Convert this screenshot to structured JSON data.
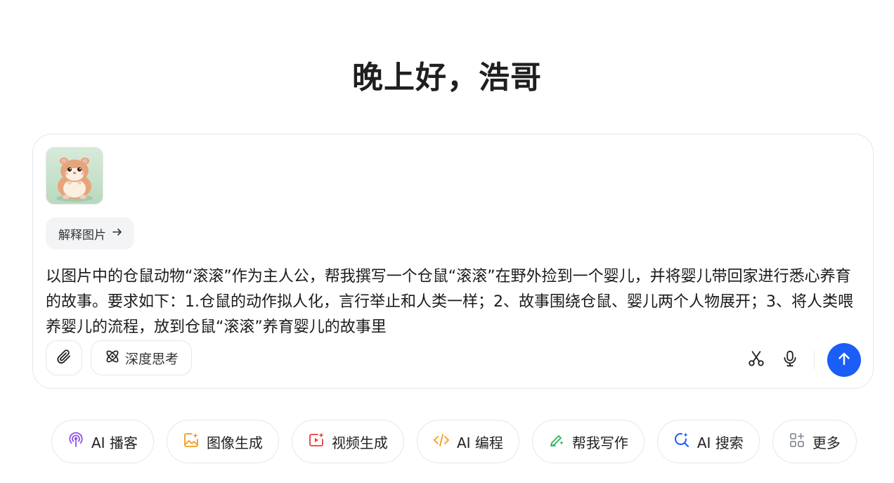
{
  "greeting": "晚上好，浩哥",
  "attachment": {
    "thumbnail_icon": "hamster-image-thumbnail"
  },
  "explain_chip": {
    "label": "解释图片",
    "icon": "arrow-right-icon"
  },
  "prompt": {
    "text": "以图片中的仓鼠动物“滚滚”作为主人公，帮我撰写一个仓鼠“滚滚”在野外捡到一个婴儿，并将婴儿带回家进行悉心养育的故事。要求如下：1.仓鼠的动作拟人化，言行举止和人类一样；2、故事围绕仓鼠、婴儿两个人物展开；3、将人类喂养婴儿的流程，放到仓鼠“滚滚”养育婴儿的故事里"
  },
  "toolbar": {
    "attach_icon": "paperclip-icon",
    "deep_think_label": "深度思考",
    "deep_think_icon": "atom-icon",
    "scissors_icon": "scissors-icon",
    "mic_icon": "microphone-icon",
    "send_icon": "arrow-up-icon",
    "send_color": "#1a5df7"
  },
  "quick_actions": [
    {
      "label": "AI 播客",
      "icon": "podcast-icon",
      "color": "#8e4de8"
    },
    {
      "label": "图像生成",
      "icon": "image-sparkle-icon",
      "color": "#f29b1b"
    },
    {
      "label": "视频生成",
      "icon": "video-sparkle-icon",
      "color": "#ee3b3b"
    },
    {
      "label": "AI 编程",
      "icon": "code-icon",
      "color": "#f29b1b"
    },
    {
      "label": "帮我写作",
      "icon": "pen-sparkle-icon",
      "color": "#2fb25b"
    },
    {
      "label": "AI 搜索",
      "icon": "search-sparkle-icon",
      "color": "#1a5df7"
    },
    {
      "label": "更多",
      "icon": "grid-more-icon",
      "color": "#8a8f99"
    }
  ]
}
